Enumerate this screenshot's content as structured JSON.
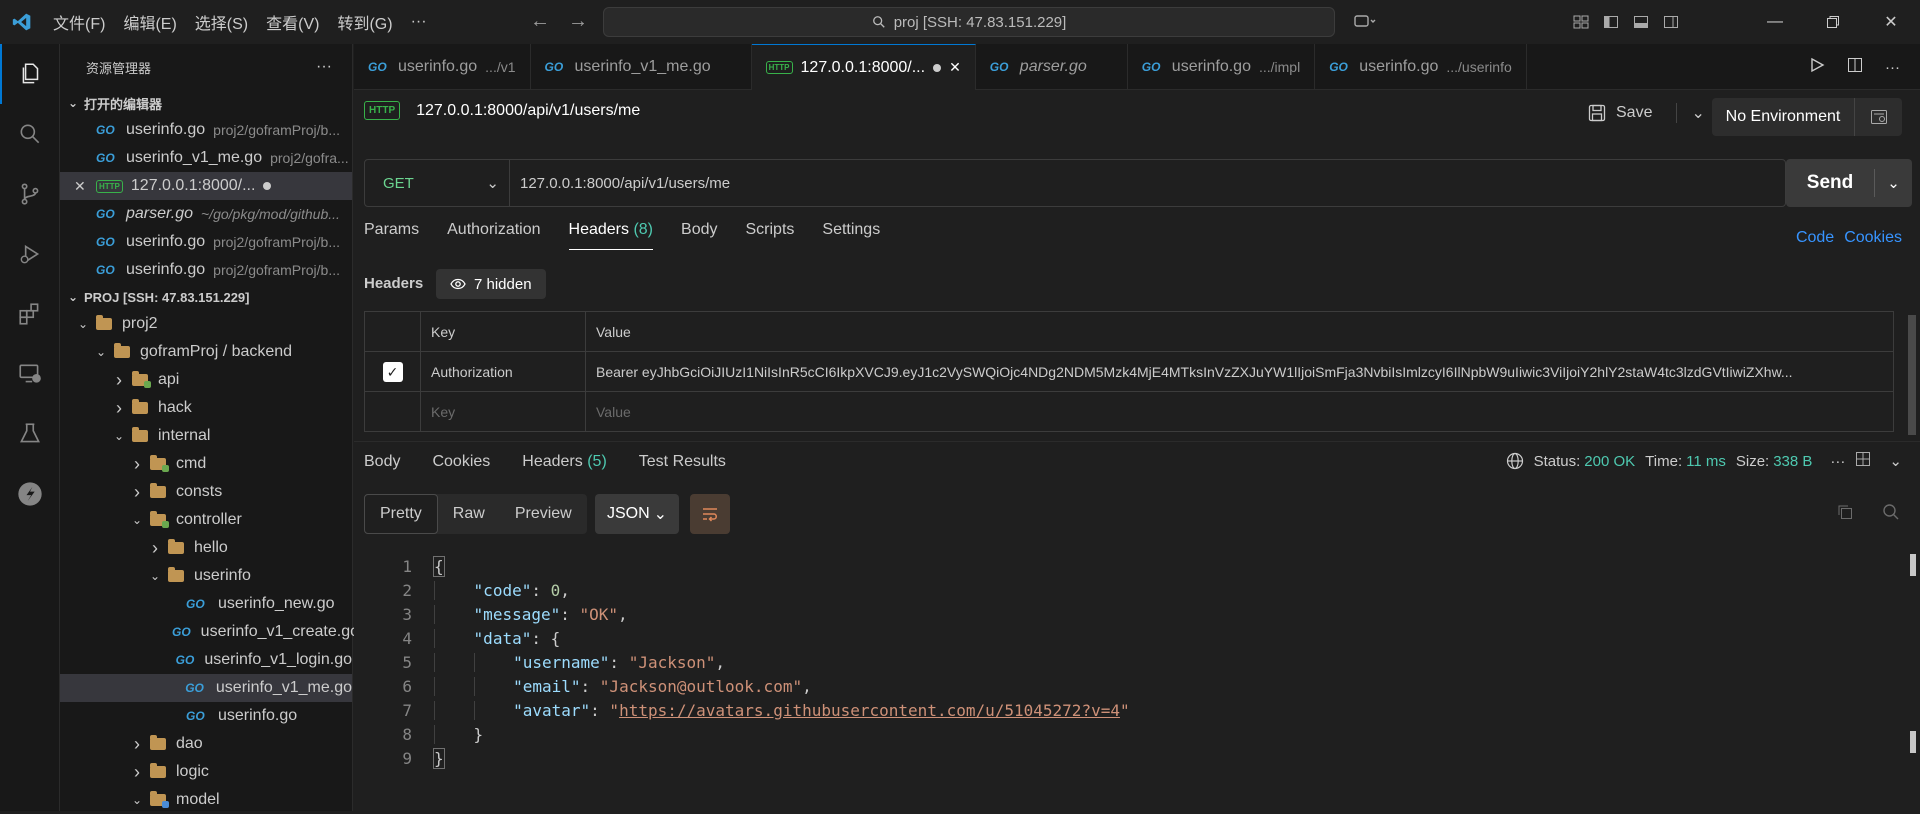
{
  "titlebar": {
    "menus": [
      "文件(F)",
      "编辑(E)",
      "选择(S)",
      "查看(V)",
      "转到(G)",
      "···"
    ],
    "search": "proj [SSH: 47.83.151.229]"
  },
  "sidebar": {
    "title": "资源管理器",
    "open_editors_label": "打开的编辑器",
    "open_editors": [
      {
        "name": "userinfo.go",
        "path": "proj2/goframProj/b..."
      },
      {
        "name": "userinfo_v1_me.go",
        "path": "proj2/gofra..."
      },
      {
        "name": "127.0.0.1:8000/...",
        "path": ""
      },
      {
        "name": "parser.go",
        "path": "~/go/pkg/mod/github..."
      },
      {
        "name": "userinfo.go",
        "path": "proj2/goframProj/b..."
      },
      {
        "name": "userinfo.go",
        "path": "proj2/goframProj/b..."
      }
    ],
    "workspace_label": "PROJ [SSH: 47.83.151.229]",
    "tree": [
      {
        "label": "proj2",
        "kind": "folder",
        "level": 0,
        "chev": "v"
      },
      {
        "label": "goframProj / backend",
        "kind": "folder",
        "level": 1,
        "chev": "v"
      },
      {
        "label": "api",
        "kind": "folder-badge",
        "level": 2,
        "chev": ">"
      },
      {
        "label": "hack",
        "kind": "folder",
        "level": 2,
        "chev": ">"
      },
      {
        "label": "internal",
        "kind": "folder",
        "level": 2,
        "chev": "v"
      },
      {
        "label": "cmd",
        "kind": "folder-badge",
        "level": 3,
        "chev": ">"
      },
      {
        "label": "consts",
        "kind": "folder",
        "level": 3,
        "chev": ">"
      },
      {
        "label": "controller",
        "kind": "folder-badge",
        "level": 3,
        "chev": "v"
      },
      {
        "label": "hello",
        "kind": "folder",
        "level": 4,
        "chev": ">"
      },
      {
        "label": "userinfo",
        "kind": "folder",
        "level": 4,
        "chev": "v"
      },
      {
        "label": "userinfo_new.go",
        "kind": "go",
        "level": 5,
        "chev": ""
      },
      {
        "label": "userinfo_v1_create.go",
        "kind": "go",
        "level": 5,
        "chev": ""
      },
      {
        "label": "userinfo_v1_login.go",
        "kind": "go",
        "level": 5,
        "chev": ""
      },
      {
        "label": "userinfo_v1_me.go",
        "kind": "go",
        "level": 5,
        "chev": "",
        "selected": true
      },
      {
        "label": "userinfo.go",
        "kind": "go",
        "level": 5,
        "chev": ""
      },
      {
        "label": "dao",
        "kind": "folder",
        "level": 3,
        "chev": ">"
      },
      {
        "label": "logic",
        "kind": "folder",
        "level": 3,
        "chev": ">"
      },
      {
        "label": "model",
        "kind": "folder-badge-blue",
        "level": 3,
        "chev": "v"
      }
    ]
  },
  "tabs": [
    {
      "name": "userinfo.go",
      "dim": ".../v1",
      "icon": "go"
    },
    {
      "name": "userinfo_v1_me.go",
      "dim": "",
      "icon": "go"
    },
    {
      "name": "127.0.0.1:8000/...",
      "dim": "",
      "icon": "http",
      "active": true
    },
    {
      "name": "parser.go",
      "dim": "",
      "icon": "go",
      "italic": true
    },
    {
      "name": "userinfo.go",
      "dim": ".../impl",
      "icon": "go"
    },
    {
      "name": "userinfo.go",
      "dim": ".../userinfo",
      "icon": "go"
    }
  ],
  "request": {
    "title": "127.0.0.1:8000/api/v1/users/me",
    "save_label": "Save",
    "environment": "No Environment",
    "method": "GET",
    "url": "127.0.0.1:8000/api/v1/users/me",
    "send_label": "Send",
    "tabs": {
      "params": "Params",
      "authorization": "Authorization",
      "headers": "Headers",
      "headers_count": "(8)",
      "body": "Body",
      "scripts": "Scripts",
      "settings": "Settings"
    },
    "code_link": "Code",
    "cookies_link": "Cookies",
    "headers_label": "Headers",
    "hidden_label": "7 hidden",
    "table": {
      "col_key": "Key",
      "col_value": "Value",
      "row_key": "Authorization",
      "row_value": "Bearer eyJhbGciOiJIUzI1NiIsInR5cCI6IkpXVCJ9.eyJ1c2VySWQiOjc4NDg2NDM5Mzk4MjE4MTksInVzZXJuYW1lIjoiSmFja3NvbiIsImlzcyI6IlNpbW9uIiwic3ViIjoiY2hlY2staW4tc3lzdGVtIiwiZXhw...",
      "key_placeholder": "Key",
      "value_placeholder": "Value"
    }
  },
  "response": {
    "tabs": {
      "body": "Body",
      "cookies": "Cookies",
      "headers": "Headers",
      "headers_count": "(5)",
      "test_results": "Test Results"
    },
    "status_label": "Status:",
    "status_value": "200 OK",
    "time_label": "Time:",
    "time_value": "11 ms",
    "size_label": "Size:",
    "size_value": "338 B",
    "views": {
      "pretty": "Pretty",
      "raw": "Raw",
      "preview": "Preview"
    },
    "format": "JSON",
    "json": {
      "code_key": "\"code\"",
      "code_val": "0",
      "message_key": "\"message\"",
      "message_val": "\"OK\"",
      "data_key": "\"data\"",
      "username_key": "\"username\"",
      "username_val": "\"Jackson\"",
      "email_key": "\"email\"",
      "email_val": "\"Jackson@outlook.com\"",
      "avatar_key": "\"avatar\"",
      "avatar_val": "https://avatars.githubusercontent.com/u/51045272?v=4"
    },
    "line_numbers": [
      "1",
      "2",
      "3",
      "4",
      "5",
      "6",
      "7",
      "8",
      "9"
    ]
  }
}
